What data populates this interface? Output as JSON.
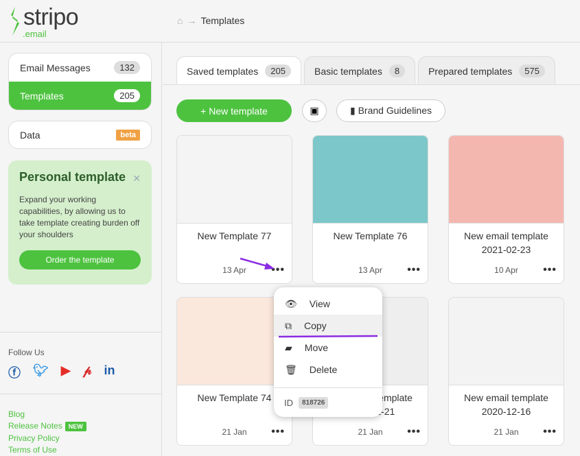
{
  "logo": {
    "word": "stripo",
    "suffix": ".email",
    "color": "#4dc23f"
  },
  "breadcrumb": {
    "current": "Templates"
  },
  "sidebar": {
    "items": [
      {
        "label": "Email Messages",
        "count": "132"
      },
      {
        "label": "Templates",
        "count": "205"
      }
    ],
    "data": {
      "label": "Data",
      "badge": "beta"
    },
    "promo": {
      "title": "Personal template",
      "text": "Expand your working capabilities, by allowing us to take template creating burden off your shoulders",
      "button": "Order the template"
    },
    "follow": "Follow Us",
    "social": [
      "facebook",
      "twitter",
      "youtube",
      "pinterest",
      "linkedin"
    ],
    "links": [
      "Blog",
      "Release Notes",
      "Privacy Policy",
      "Terms of Use"
    ],
    "new_badge": "NEW"
  },
  "tabs": [
    {
      "label": "Saved templates",
      "count": "205"
    },
    {
      "label": "Basic templates",
      "count": "8"
    },
    {
      "label": "Prepared templates",
      "count": "575"
    }
  ],
  "toolbar": {
    "new_template": "New template",
    "brand": "Brand Guidelines"
  },
  "cards": [
    {
      "name": "New Template 77",
      "date": "13 Apr",
      "thumb": "#f4f4f4"
    },
    {
      "name": "New Template 76",
      "date": "13 Apr",
      "thumb": "#7cc7c9"
    },
    {
      "name": "New email template 2021-02-23",
      "date": "10 Apr",
      "thumb": "#f4b7b0"
    },
    {
      "name": "New Template 74",
      "date": "21 Jan",
      "thumb": "#fbe8dc"
    },
    {
      "name": "New email template 2020-12-21",
      "date": "21 Jan",
      "thumb": "#eeeeee"
    },
    {
      "name": "New email template 2020-12-16",
      "date": "21 Jan",
      "thumb": "#f3f3f3"
    }
  ],
  "menu": {
    "items": [
      "View",
      "Copy",
      "Move",
      "Delete"
    ],
    "id_label": "ID",
    "id_value": "818726"
  }
}
